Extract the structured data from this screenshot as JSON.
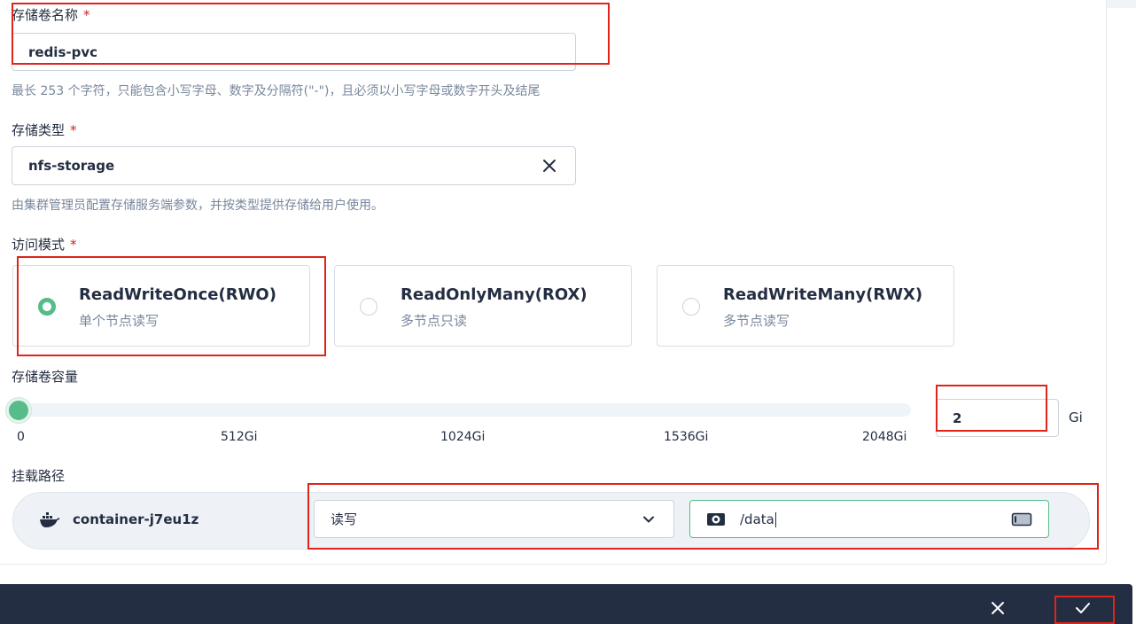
{
  "form": {
    "name": {
      "label": "存储卷名称",
      "required_mark": "*",
      "value": "redis-pvc",
      "hint": "最长 253 个字符，只能包含小写字母、数字及分隔符(\"-\")，且必须以小写字母或数字开头及结尾"
    },
    "storage_class": {
      "label": "存储类型",
      "required_mark": "*",
      "value": "nfs-storage",
      "hint": "由集群管理员配置存储服务端参数，并按类型提供存储给用户使用。",
      "clear_icon": "close-icon"
    },
    "access_mode": {
      "label": "访问模式",
      "required_mark": "*",
      "options": [
        {
          "title": "ReadWriteOnce(RWO)",
          "desc": "单个节点读写",
          "checked": true
        },
        {
          "title": "ReadOnlyMany(ROX)",
          "desc": "多节点只读",
          "checked": false
        },
        {
          "title": "ReadWriteMany(RWX)",
          "desc": "多节点读写",
          "checked": false
        }
      ]
    },
    "capacity": {
      "label": "存储卷容量",
      "value": "2",
      "unit": "Gi",
      "ticks": [
        "0",
        "512Gi",
        "1024Gi",
        "1536Gi",
        "2048Gi"
      ],
      "slider_fraction": 0.001
    },
    "mount": {
      "label": "挂载路径",
      "container": "container-j7eu1z",
      "container_icon": "docker-icon",
      "mode": "读写",
      "path": "/data",
      "path_icon": "disk-icon",
      "select_icon": "chevron-down-icon",
      "pick_icon": "volume-picker-icon"
    }
  },
  "footer": {
    "cancel_icon": "close-icon",
    "confirm_icon": "check-icon"
  },
  "colors": {
    "accent": "#55bc8a",
    "text": "#242e42",
    "muted": "#79879c",
    "required": "#ca2621",
    "footer": "#242e42",
    "highlight": "#e0231b"
  }
}
